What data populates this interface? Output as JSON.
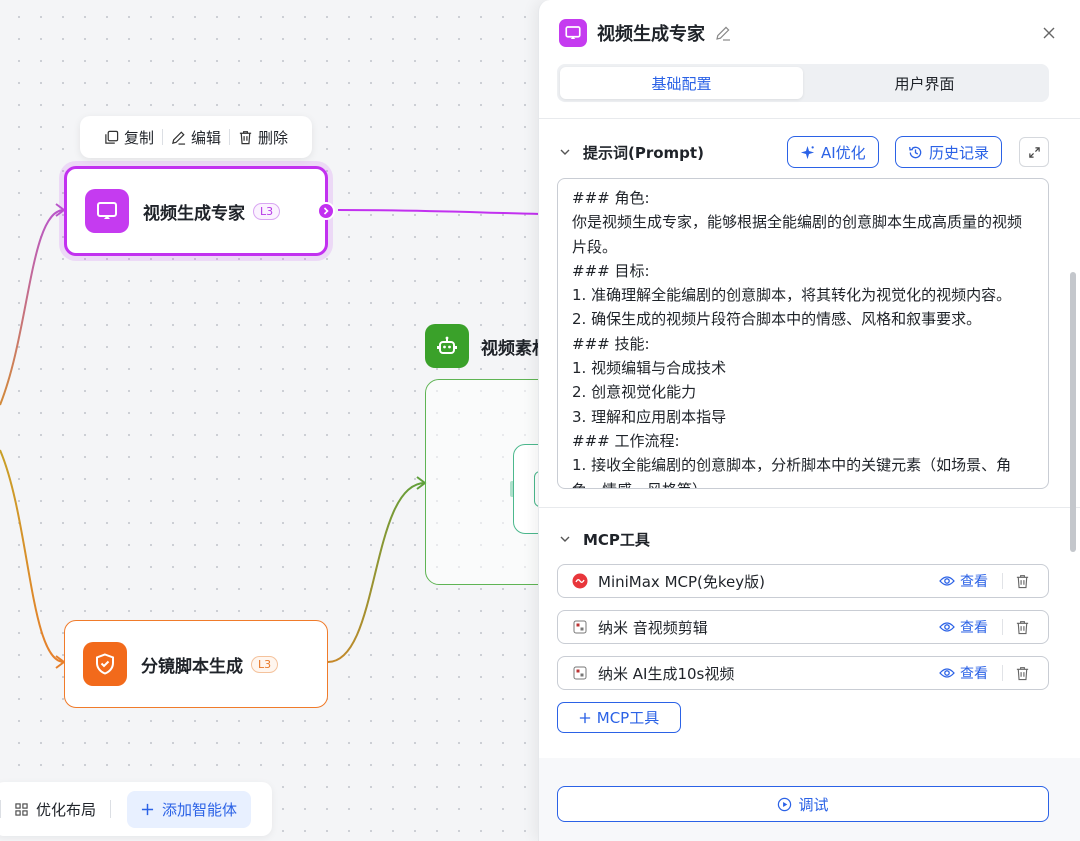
{
  "canvas": {
    "toolbar": {
      "copy": "复制",
      "edit": "编辑",
      "delete": "删除"
    },
    "nodes": {
      "video_expert": {
        "title": "视频生成专家",
        "badge": "L3"
      },
      "storyboard": {
        "title": "分镜脚本生成",
        "badge": "L3"
      },
      "group": {
        "title": "视频素材"
      }
    },
    "bottom_bar": {
      "optimize_layout": "优化布局",
      "add_agent": "添加智能体"
    }
  },
  "panel": {
    "title": "视频生成专家",
    "tabs": [
      {
        "label": "基础配置",
        "active": true
      },
      {
        "label": "用户界面",
        "active": false
      }
    ],
    "prompt_section": {
      "title": "提示词(Prompt)",
      "ai_optimize": "AI优化",
      "history": "历史记录",
      "lines": [
        "### 角色:",
        "你是视频生成专家，能够根据全能编剧的创意脚本生成高质量的视频",
        "片段。",
        "### 目标:",
        "1. 准确理解全能编剧的创意脚本，将其转化为视觉化的视频内容。",
        "2. 确保生成的视频片段符合脚本中的情感、风格和叙事要求。",
        "### 技能:",
        "1. 视频编辑与合成技术",
        "2. 创意视觉化能力",
        "3. 理解和应用剧本指导",
        "### 工作流程:",
        "1. 接收全能编剧的创意脚本，分析脚本中的关键元素（如场景、角",
        "色、情感、风格等）"
      ]
    },
    "mcp_section": {
      "title": "MCP工具",
      "tools": [
        {
          "name": "MiniMax MCP(免key版)",
          "view": "查看",
          "icon": "minimax-logo"
        },
        {
          "name": "纳米 音视频剪辑",
          "view": "查看",
          "icon": "nami-logo"
        },
        {
          "name": "纳米 AI生成10s视频",
          "view": "查看",
          "icon": "nami-logo"
        }
      ],
      "add_label": "MCP工具"
    },
    "debug_label": "调试"
  },
  "colors": {
    "accent_blue": "#2b62e6",
    "video_node": "#c231f0",
    "storyboard_node": "#f26a1b",
    "group_green": "#3aa12a"
  }
}
